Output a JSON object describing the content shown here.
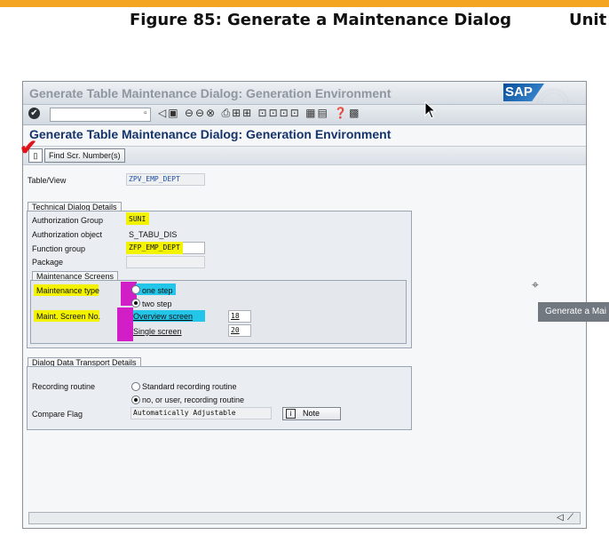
{
  "page": {
    "figure_title": "Figure 85: Generate a Maintenance Dialog",
    "unit_label": "Unit"
  },
  "window": {
    "title": "Generate Table Maintenance Dialog: Generation Environment",
    "logo": "SAP"
  },
  "screen": {
    "title": "Generate Table Maintenance Dialog: Generation Environment"
  },
  "toolbar": {
    "enter_icon": "✔",
    "command_value": ""
  },
  "app_toolbar": {
    "find_label": "Find Scr. Number(s)"
  },
  "table_view": {
    "label": "Table/View",
    "value": "ZPV_EMP_DEPT"
  },
  "technical": {
    "group_title": "Technical Dialog Details",
    "auth_group_label": "Authorization Group",
    "auth_group_value": "SUNI",
    "auth_object_label": "Authorization object",
    "auth_object_value": "S_TABU_DIS",
    "function_group_label": "Function group",
    "function_group_value": "ZFP_EMP_DEPT",
    "package_label": "Package",
    "package_value": ""
  },
  "maint_screens": {
    "group_title": "Maintenance Screens",
    "type_label": "Maintenance type",
    "one_step": "one step",
    "two_step": "two step",
    "selected": "two step",
    "screen_no_label": "Maint. Screen No.",
    "overview_label": "Overview screen",
    "overview_value": "18",
    "single_label": "Single screen",
    "single_value": "20"
  },
  "transport": {
    "group_title": "Dialog Data Transport Details",
    "recording_label": "Recording routine",
    "standard_option": "Standard recording routine",
    "no_option": "no, or user, recording routine",
    "selected": "no, or user, recording routine",
    "compare_label": "Compare Flag",
    "compare_value": "Automatically Adjustable",
    "note_label": "Note"
  },
  "tooltip": {
    "text": "Generate a Mai"
  },
  "colors": {
    "highlight_yellow": "#f3f300",
    "highlight_magenta": "#d21ec6",
    "highlight_cyan": "#23c6e8",
    "title_blue": "#15346a",
    "accent_orange": "#f4a623"
  }
}
